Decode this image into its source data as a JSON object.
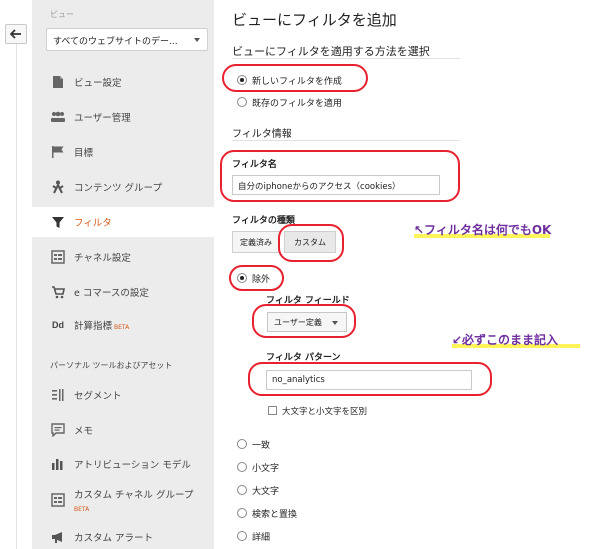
{
  "back": {
    "icon": "back-arrow-icon"
  },
  "sidebar": {
    "view_label": "ビュー",
    "view_select": "すべてのウェブサイトのデー...",
    "items": [
      {
        "label": "ビュー設定",
        "icon": "document-icon"
      },
      {
        "label": "ユーザー管理",
        "icon": "users-icon"
      },
      {
        "label": "目標",
        "icon": "flag-icon"
      },
      {
        "label": "コンテンツ グループ",
        "icon": "person-grouping-icon"
      },
      {
        "label": "フィルタ",
        "icon": "filter-icon",
        "active": true
      },
      {
        "label": "チャネル設定",
        "icon": "channel-icon"
      },
      {
        "label": "e コマースの設定",
        "icon": "cart-icon"
      },
      {
        "label": "計算指標",
        "icon": "dd-icon",
        "badge": "BETA"
      }
    ],
    "section_heading": "パーソナル ツールおよびアセット",
    "items2": [
      {
        "label": "セグメント",
        "icon": "segment-icon"
      },
      {
        "label": "メモ",
        "icon": "memo-icon"
      },
      {
        "label": "アトリビューション モデル",
        "icon": "bar-chart-icon"
      },
      {
        "label": "カスタム チャネル グループ",
        "icon": "custom-channel-icon",
        "badge": "BETA"
      },
      {
        "label": "カスタム アラート",
        "icon": "megaphone-icon"
      }
    ]
  },
  "main": {
    "title": "ビューにフィルタを追加",
    "method_heading": "ビューにフィルタを適用する方法を選択",
    "method_options": [
      "新しいフィルタを作成",
      "既存のフィルタを適用"
    ],
    "filter_info": "フィルタ情報",
    "filter_name_label": "フィルタ名",
    "filter_name_value": "自分のiphoneからのアクセス（cookies）",
    "filter_type_label": "フィルタの種類",
    "type_tabs": [
      "定義済み",
      "カスタム"
    ],
    "exclude_label": "除外",
    "filter_field_label": "フィルタ フィールド",
    "filter_field_value": "ユーザー定義",
    "filter_pattern_label": "フィルタ パターン",
    "filter_pattern_value": "no_analytics",
    "case_sensitive": "大文字と小文字を区別",
    "other_options": [
      "一致",
      "小文字",
      "大文字",
      "検索と置換",
      "詳細"
    ]
  },
  "annotations": {
    "name_note": "↖フィルタ名は何でもOK",
    "pattern_note": "↙必ずこのまま記入"
  },
  "colors": {
    "accent": "#d55a1a",
    "annotation": "#6f2f9f",
    "circle": "#e8212f",
    "highlight": "#fff45a"
  }
}
